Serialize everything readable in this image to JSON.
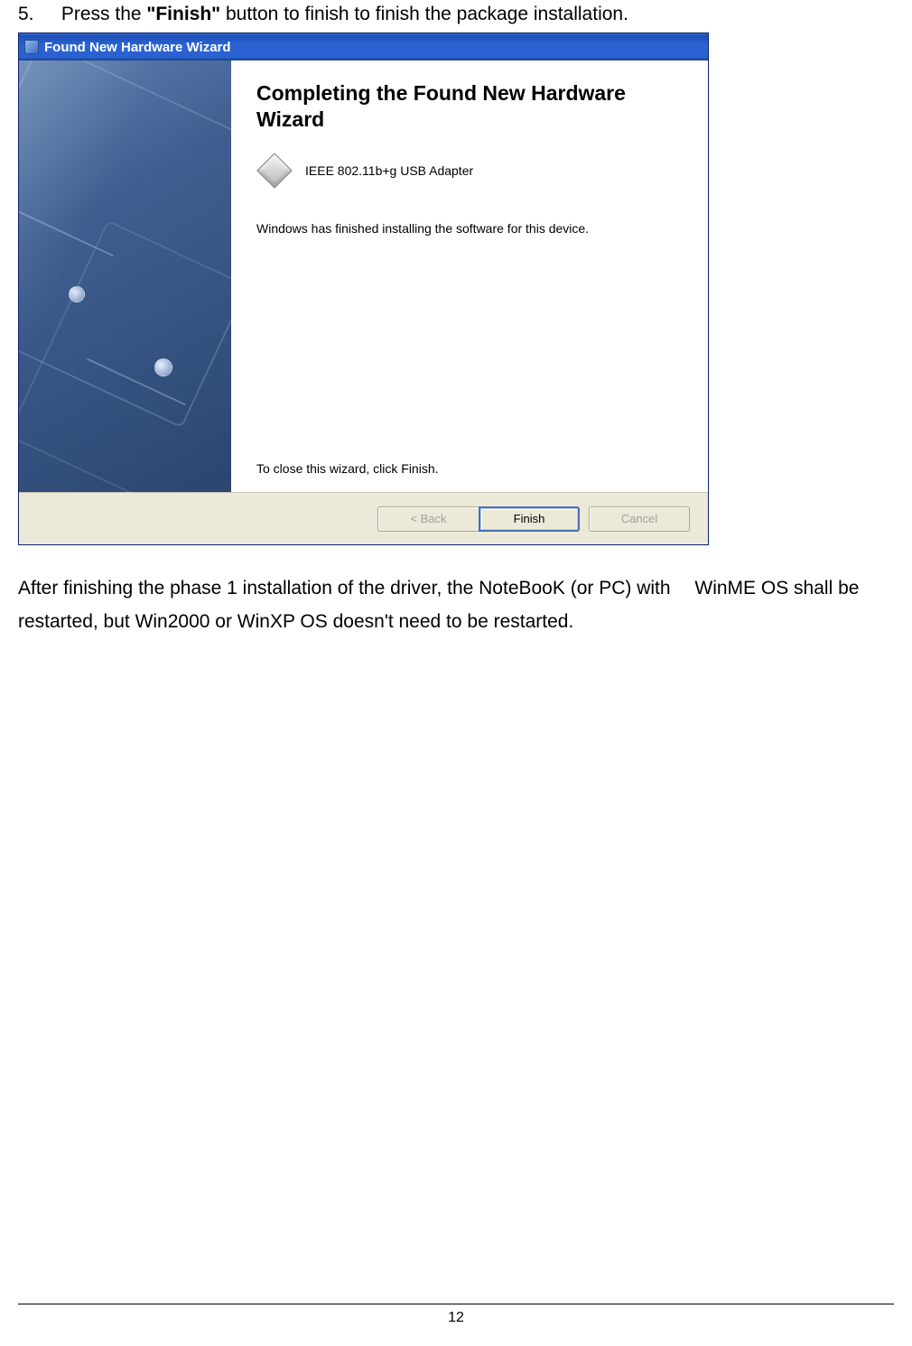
{
  "instruction": {
    "number": "5.",
    "pre": "Press the ",
    "bold": "\"Finish\"",
    "post": " button to finish to finish the package installation."
  },
  "wizard": {
    "title": "Found New Hardware Wizard",
    "heading": "Completing the Found New Hardware Wizard",
    "device": "IEEE 802.11b+g USB Adapter",
    "status": "Windows has finished installing the software for this device.",
    "closeHint": "To close this wizard, click Finish.",
    "buttons": {
      "back": "< Back",
      "finish": "Finish",
      "cancel": "Cancel"
    }
  },
  "paragraph": "After finishing the phase 1 installation of the driver, the NoteBooK (or PC) with  WinME OS shall be restarted, but Win2000 or WinXP OS doesn't need to be restarted.",
  "pageNumber": "12"
}
